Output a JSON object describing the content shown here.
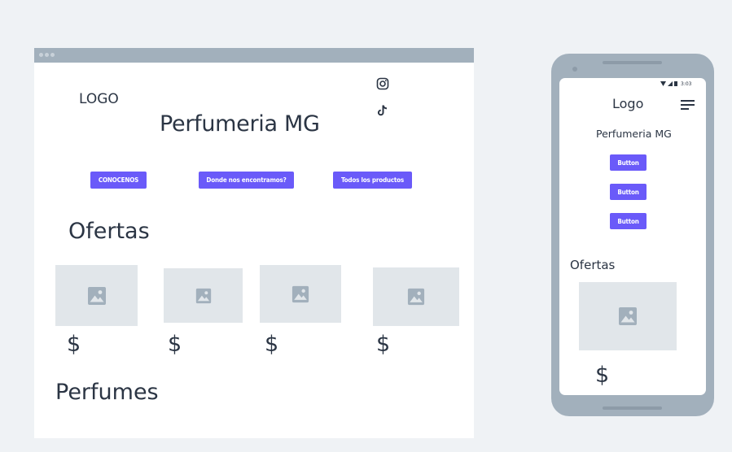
{
  "desktop": {
    "logo": "LOGO",
    "site_title": "Perfumeria MG",
    "social_icons": [
      "instagram-icon",
      "tiktok-icon"
    ],
    "nav_buttons": [
      "CONOCENOS",
      "Donde nos encontramos?",
      "Todos los productos"
    ],
    "offers_heading": "Ofertas",
    "offer_prices": [
      "$",
      "$",
      "$",
      "$"
    ],
    "perfumes_heading": "Perfumes"
  },
  "mobile": {
    "status_time": "3:03",
    "logo": "Logo",
    "menu_icon": "hamburger-icon",
    "site_title": "Perfumeria MG",
    "buttons": [
      "Button",
      "Button",
      "Button"
    ],
    "offers_heading": "Ofertas",
    "offer_price": "$"
  },
  "colors": {
    "background": "#eff2f5",
    "frame": "#a2b0bc",
    "accent": "#6a5af9",
    "placeholder": "#e1e6ea",
    "text": "#2b3544"
  }
}
